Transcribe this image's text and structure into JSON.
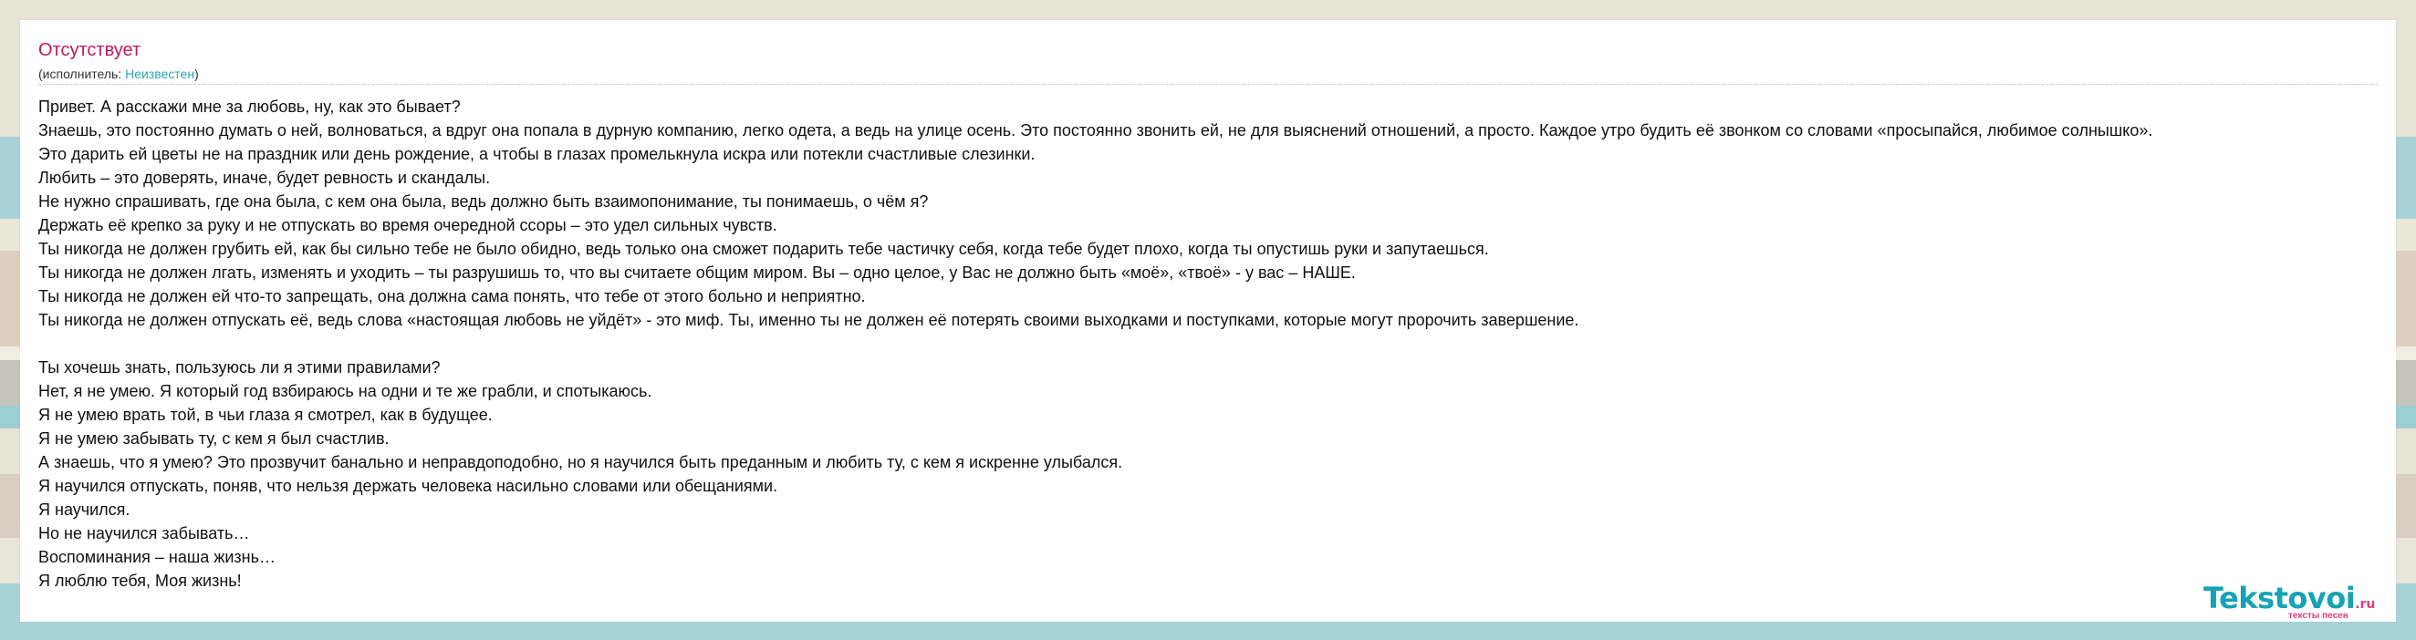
{
  "song": {
    "title": "Отсутствует",
    "performer_prefix": "(исполнитель: ",
    "performer_name": "Неизвестен",
    "performer_suffix": ")"
  },
  "lyrics": [
    "Привет. А расскажи мне за любовь, ну, как это бывает?",
    "Знаешь, это постоянно думать о ней, волноваться, а вдруг она попала в дурную компанию, легко одета, а ведь на улице осень. Это постоянно звонить ей, не для выяснений отношений, а просто. Каждое утро будить её звонком со словами «просыпайся, любимое солнышко».",
    "Это дарить ей цветы не на праздник или день рождение, а чтобы в глазах промелькнула искра или потекли счастливые слезинки.",
    "Любить – это доверять, иначе, будет ревность и скандалы.",
    "Не нужно спрашивать, где она была, с кем она была, ведь должно быть взаимопонимание, ты понимаешь, о чём я?",
    "Держать её крепко за руку и не отпускать во время очередной ссоры – это удел сильных чувств.",
    "Ты никогда не должен грубить ей, как бы сильно тебе не было обидно, ведь только она сможет подарить тебе частичку себя, когда тебе будет плохо, когда ты опустишь руки и запутаешься.",
    "Ты никогда не должен лгать, изменять и уходить – ты разрушишь то, что вы считаете общим миром. Вы – одно целое, у Вас не должно быть «моё», «твоё» - у вас – НАШЕ.",
    "Ты никогда не должен ей что-то запрещать, она должна сама понять, что тебе от этого больно и неприятно.",
    "Ты никогда не должен отпускать её, ведь слова «настоящая любовь не уйдёт» - это миф. Ты, именно ты не должен её потерять своими выходками и поступками, которые могут пророчить завершение.",
    "",
    "Ты хочешь знать, пользуюсь ли я этими правилами?",
    "Нет, я не умею. Я который год взбираюсь на одни и те же грабли, и спотыкаюсь.",
    "Я не умею врать той, в чьи глаза я смотрел, как в будущее.",
    "Я не умею забывать ту, с кем я был счастлив.",
    "А знаешь, что я умею? Это прозвучит банально и неправдоподобно, но я научился быть преданным и любить ту, с кем я искренне улыбался.",
    "Я научился отпускать, поняв, что нельзя держать человека насильно словами или обещаниями.",
    "Я научился.",
    "Но не научился забывать…",
    "Воспоминания – наша жизнь…",
    "Я люблю тебя, Моя жизнь!"
  ],
  "logo": {
    "brand": "Tekstovoi",
    "tld": ".ru",
    "tagline": "тексты песен"
  }
}
